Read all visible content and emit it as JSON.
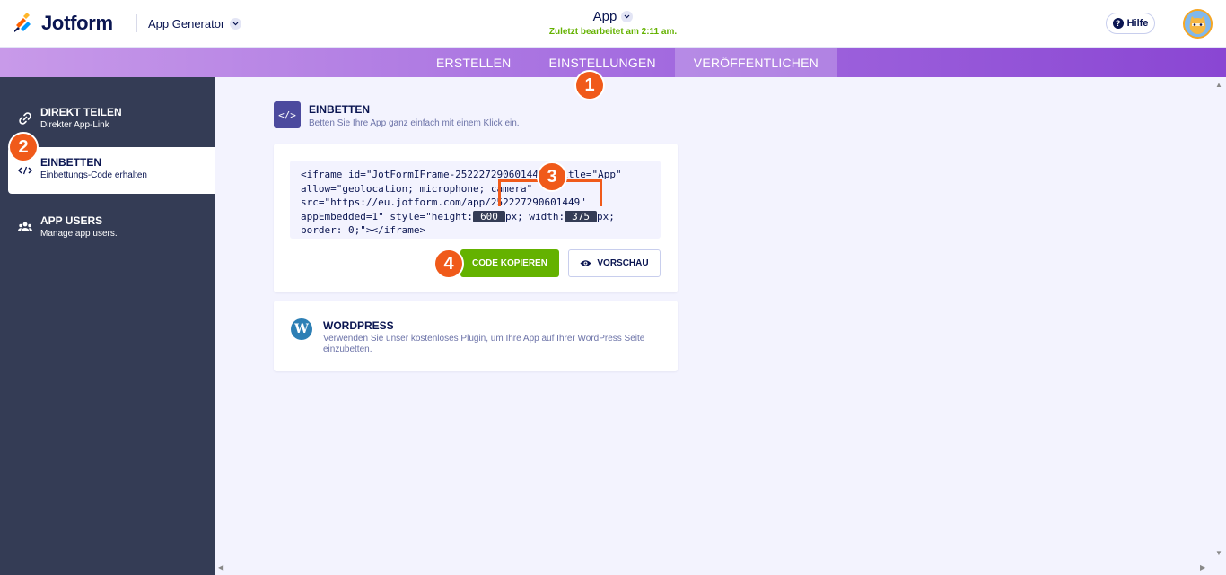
{
  "header": {
    "brand": "Jotform",
    "app_generator_label": "App Generator",
    "app_title": "App",
    "last_edited": "Zuletzt bearbeitet am 2:11 am.",
    "help_label": "Hilfe"
  },
  "nav": {
    "tabs": [
      {
        "label": "ERSTELLEN"
      },
      {
        "label": "EINSTELLUNGEN"
      },
      {
        "label": "VERÖFFENTLICHEN"
      }
    ]
  },
  "sidebar": {
    "items": [
      {
        "title": "DIREKT TEILEN",
        "subtitle": "Direkter App-Link"
      },
      {
        "title": "EINBETTEN",
        "subtitle": "Einbettungs-Code erhalten"
      },
      {
        "title": "APP USERS",
        "subtitle": "Manage app users."
      }
    ]
  },
  "embed": {
    "title": "EINBETTEN",
    "subtitle": "Betten Sie Ihre App ganz einfach mit einem Klick ein.",
    "code_line1": "<iframe id=\"JotFormIFrame-252227290601449\" title=\"App\"",
    "code_line2": "allow=\"geolocation; microphone; camera\"",
    "code_line3": "src=\"https://eu.jotform.com/app/252227290601449\"",
    "code_line4a": "appEmbedded=1\" style=\"height:",
    "height_value": "600",
    "code_line4b": "px; width:",
    "width_value": "375",
    "code_line4c": "px;",
    "code_line5": "border: 0;\"></iframe>",
    "copy_button": "CODE KOPIEREN",
    "preview_button": "VORSCHAU"
  },
  "wordpress": {
    "title": "WORDPRESS",
    "subtitle": "Verwenden Sie unser kostenloses Plugin, um Ihre App auf Ihrer WordPress Seite einzubetten."
  },
  "annotations": [
    "1",
    "2",
    "3",
    "4"
  ],
  "colors": {
    "accent_purple": "#a56ee0",
    "sidebar_bg": "#343c55",
    "green": "#64b200",
    "annotation_orange": "#f05a1a"
  }
}
